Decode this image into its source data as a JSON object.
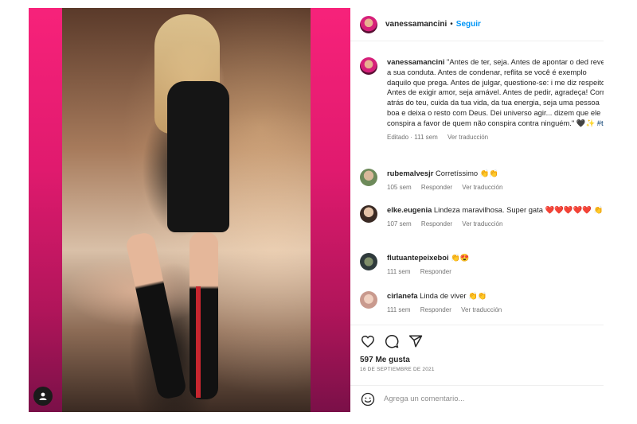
{
  "post": {
    "username": "vanessamancini",
    "follow_label": "Seguir",
    "separator": "•"
  },
  "caption": {
    "username": "vanessamancini",
    "text": "\"Antes de ter, seja. Antes de apontar o ded reveja a sua conduta. Antes de condenar, reflita se você é exemplo daquilo que prega. Antes de julgar, questione-se: i me diz respeito? Antes de exigir amor, seja amável. Antes de pedir, agradeça! Corra atrás do teu, cuida da tua vida, da tua energia, seja uma pessoa boa e deixa o resto com Deus. Dei universo agir... dizem que ele conspira a favor de quem não conspira contra ninguém.\" 🖤✨ ",
    "hashtag": "#tbt",
    "meta_edited": "Editado · 111 sem",
    "meta_translate": "Ver traducción"
  },
  "comments": [
    {
      "username": "rubemalvesjr",
      "text": "Corretíssimo 👏👏",
      "time": "105 sem",
      "reply": "Responder",
      "translate": "Ver traducción",
      "avatar_color": "#6d8a5a"
    },
    {
      "username": "elke.eugenia",
      "text": "Lindeza maravilhosa. Super gata ❤️❤️❤️❤️❤️ 👏",
      "time": "107 sem",
      "reply": "Responder",
      "translate": "Ver traducción",
      "avatar_color": "#3a2a24"
    },
    {
      "username": "flutuantepeixeboi",
      "text": "👏😍",
      "time": "111 sem",
      "reply": "Responder",
      "translate": "",
      "avatar_color": "#2f3a3c"
    },
    {
      "username": "cirlanefa",
      "text": "Linda de viver 👏👏",
      "time": "111 sem",
      "reply": "Responder",
      "translate": "Ver traducción",
      "avatar_color": "#c99a8e"
    }
  ],
  "actions": {
    "like_icon": "heart-icon",
    "comment_icon": "comment-icon",
    "share_icon": "share-icon"
  },
  "likes_label": "597 Me gusta",
  "date_label": "16 DE SEPTIEMBRE DE 2021",
  "add_comment": {
    "placeholder": "Agrega un comentario...",
    "emoji_icon": "smiley-icon"
  },
  "colors": {
    "accent_blue": "#0095f6",
    "photo_border_top": "#f7227a",
    "photo_border_bottom": "#7a1048"
  }
}
